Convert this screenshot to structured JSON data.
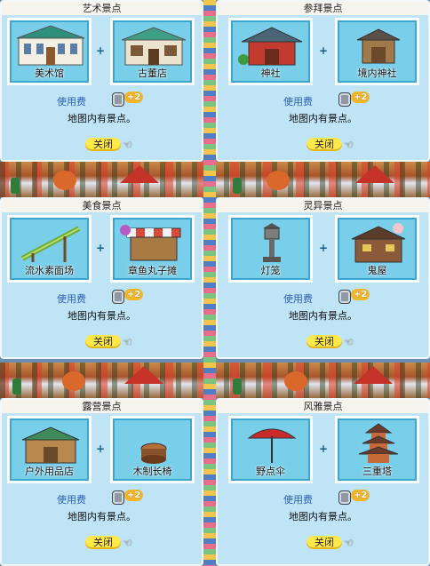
{
  "panels": [
    {
      "title": "艺术景点",
      "item1": {
        "name": "美术馆",
        "icon": "museum-building-icon"
      },
      "item2": {
        "name": "古董店",
        "icon": "antique-shop-icon"
      },
      "fee_label": "使用费",
      "fee_value": "+2",
      "message": "地图内有景点。",
      "close_label": "关闭"
    },
    {
      "title": "参拜景点",
      "item1": {
        "name": "神社",
        "icon": "shrine-icon"
      },
      "item2": {
        "name": "境内神社",
        "icon": "precinct-shrine-icon"
      },
      "fee_label": "使用费",
      "fee_value": "+2",
      "message": "地图内有景点。",
      "close_label": "关闭"
    },
    {
      "title": "美食景点",
      "item1": {
        "name": "流水素面场",
        "icon": "bamboo-flume-icon"
      },
      "item2": {
        "name": "章鱼丸子摊",
        "icon": "takoyaki-stall-icon"
      },
      "fee_label": "使用费",
      "fee_value": "+2",
      "message": "地图内有景点。",
      "close_label": "关闭"
    },
    {
      "title": "灵异景点",
      "item1": {
        "name": "灯笼",
        "icon": "stone-lantern-icon"
      },
      "item2": {
        "name": "鬼屋",
        "icon": "haunted-house-icon"
      },
      "fee_label": "使用费",
      "fee_value": "+2",
      "message": "地图内有景点。",
      "close_label": "关闭"
    },
    {
      "title": "露营景点",
      "item1": {
        "name": "户外用品店",
        "icon": "outdoor-shop-icon"
      },
      "item2": {
        "name": "木制长椅",
        "icon": "wooden-bench-icon"
      },
      "fee_label": "使用费",
      "fee_value": "+2",
      "message": "地图内有景点。",
      "close_label": "关闭"
    },
    {
      "title": "风雅景点",
      "item1": {
        "name": "野点伞",
        "icon": "parasol-icon"
      },
      "item2": {
        "name": "三重塔",
        "icon": "pagoda-icon"
      },
      "fee_label": "使用费",
      "fee_value": "+2",
      "message": "地图内有景点。",
      "close_label": "关闭"
    }
  ]
}
